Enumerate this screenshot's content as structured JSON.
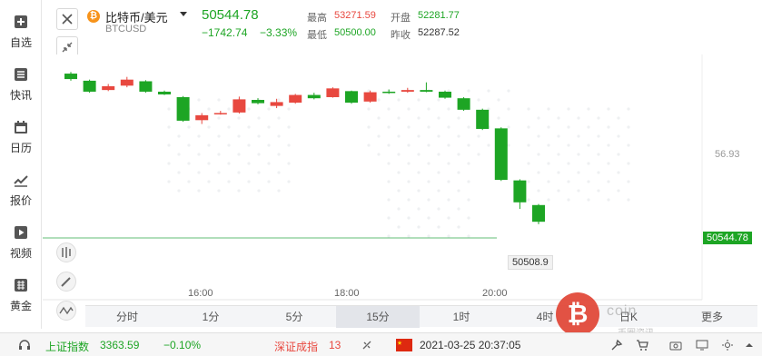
{
  "sidebar": {
    "items": [
      {
        "label": "自选",
        "icon": "plus-square-icon"
      },
      {
        "label": "快讯",
        "icon": "list-icon"
      },
      {
        "label": "日历",
        "icon": "calendar-icon"
      },
      {
        "label": "报价",
        "icon": "trend-icon"
      },
      {
        "label": "视频",
        "icon": "play-icon"
      },
      {
        "label": "黄金",
        "icon": "gold-grid-icon"
      }
    ]
  },
  "header": {
    "symbol_name": "比特币/美元",
    "symbol_code": "BTCUSD",
    "coin_glyph": "₿",
    "last_price": "50544.78",
    "change": "−1742.74",
    "change_pct": "−3.33%",
    "high_label": "最高",
    "high_value": "53271.59",
    "open_label": "开盘",
    "open_value": "52281.77",
    "low_label": "最低",
    "low_value": "50500.00",
    "prev_close_label": "昨收",
    "prev_close_value": "52287.52"
  },
  "colors": {
    "up": "#e8483f",
    "down": "#1da524",
    "accent": "#1da524"
  },
  "chart": {
    "right_tick_value": "56.93",
    "current_price_tag": "50544.78",
    "crosshair_value": "50508.9",
    "time_labels": [
      "16:00",
      "18:00",
      "20:00"
    ]
  },
  "chart_data": {
    "type": "candlestick",
    "candles": [
      {
        "o": 53250,
        "c": 53150,
        "h": 53280,
        "l": 53120
      },
      {
        "o": 53120,
        "c": 52920,
        "h": 53140,
        "l": 52900
      },
      {
        "o": 52950,
        "c": 53020,
        "h": 53060,
        "l": 52930
      },
      {
        "o": 53030,
        "c": 53140,
        "h": 53190,
        "l": 53000
      },
      {
        "o": 53110,
        "c": 52920,
        "h": 53130,
        "l": 52900
      },
      {
        "o": 52920,
        "c": 52870,
        "h": 52940,
        "l": 52860
      },
      {
        "o": 52820,
        "c": 52390,
        "h": 52840,
        "l": 52370
      },
      {
        "o": 52400,
        "c": 52490,
        "h": 52530,
        "l": 52330
      },
      {
        "o": 52510,
        "c": 52530,
        "h": 52570,
        "l": 52500
      },
      {
        "o": 52540,
        "c": 52780,
        "h": 52830,
        "l": 52520
      },
      {
        "o": 52770,
        "c": 52710,
        "h": 52800,
        "l": 52690
      },
      {
        "o": 52660,
        "c": 52730,
        "h": 52790,
        "l": 52620
      },
      {
        "o": 52720,
        "c": 52860,
        "h": 52880,
        "l": 52700
      },
      {
        "o": 52860,
        "c": 52800,
        "h": 52900,
        "l": 52780
      },
      {
        "o": 52820,
        "c": 52980,
        "h": 53000,
        "l": 52810
      },
      {
        "o": 52930,
        "c": 52720,
        "h": 52940,
        "l": 52700
      },
      {
        "o": 52740,
        "c": 52910,
        "h": 52940,
        "l": 52720
      },
      {
        "o": 52920,
        "c": 52910,
        "h": 52960,
        "l": 52880
      },
      {
        "o": 52920,
        "c": 52950,
        "h": 52990,
        "l": 52900
      },
      {
        "o": 52950,
        "c": 52920,
        "h": 53090,
        "l": 52910
      },
      {
        "o": 52920,
        "c": 52810,
        "h": 52940,
        "l": 52790
      },
      {
        "o": 52800,
        "c": 52590,
        "h": 52820,
        "l": 52570
      },
      {
        "o": 52590,
        "c": 52240,
        "h": 52610,
        "l": 52220
      },
      {
        "o": 52250,
        "c": 51310,
        "h": 52270,
        "l": 51290
      },
      {
        "o": 51300,
        "c": 50900,
        "h": 51320,
        "l": 50780
      },
      {
        "o": 50850,
        "c": 50545,
        "h": 50870,
        "l": 50500
      }
    ]
  },
  "timeframes": [
    "分时",
    "1分",
    "5分",
    "15分",
    "1时",
    "4时",
    "日K",
    "更多"
  ],
  "timeframe_selected": "15分",
  "bottom": {
    "index1_name": "上证指数",
    "index1_value": "3363.59",
    "index1_change": "−0.10%",
    "index2_name": "深证成指",
    "index2_partial": "13",
    "datetime": "2021-03-25 20:37:05"
  },
  "watermark": {
    "glyph": "₿",
    "text": "coin",
    "sub": "币圈资讯"
  }
}
